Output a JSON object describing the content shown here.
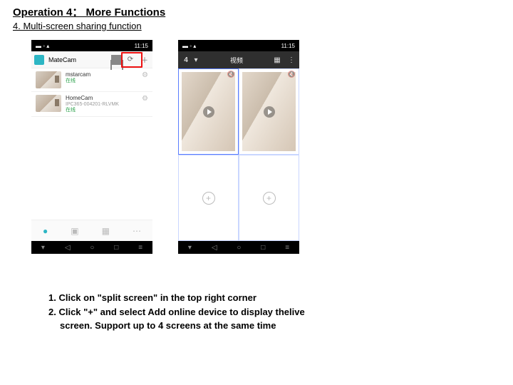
{
  "heading": "Operation 4： More Functions",
  "subheading": "4. Multi-screen sharing function",
  "phone1": {
    "status_time": "11:15",
    "app_title": "MateCam",
    "cameras": [
      {
        "name": "mstarcam",
        "desc": "",
        "status": "在线"
      },
      {
        "name": "HomeCam",
        "desc": "IPC365-004201-RLVMK",
        "status": "在线"
      }
    ]
  },
  "phone2": {
    "status_time": "11:15",
    "screen_count": "4",
    "header_title": "视频"
  },
  "instructions": {
    "line1": "1. Click on \"split screen\" in the top right corner",
    "line2": "2.  Click \"+\" and select Add online device to display thelive",
    "line2_cont": "screen. Support up to 4 screens at the same time"
  }
}
